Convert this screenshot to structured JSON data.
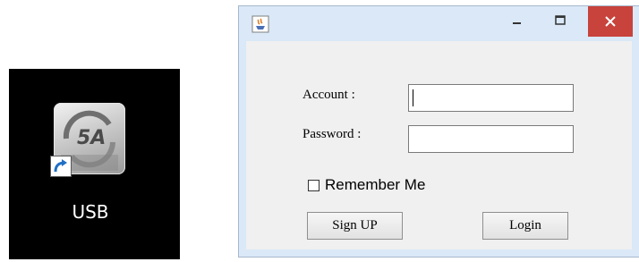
{
  "desktop": {
    "background": "#000000",
    "shortcut": {
      "label": "USB",
      "icon": "usb-app-icon",
      "overlay_icon": "shortcut-arrow-icon"
    }
  },
  "window": {
    "title_icon": "java-icon",
    "controls": {
      "minimize": "minimize-icon",
      "maximize": "maximize-icon",
      "close": "close-icon"
    },
    "close_color": "#c7433c",
    "frame_color": "#dae8f7"
  },
  "form": {
    "account_label": "Account :",
    "account_value": "",
    "password_label": "Password :",
    "password_value": "",
    "remember_label": "Remember Me",
    "remember_checked": false,
    "signup_label": "Sign UP",
    "login_label": "Login"
  }
}
